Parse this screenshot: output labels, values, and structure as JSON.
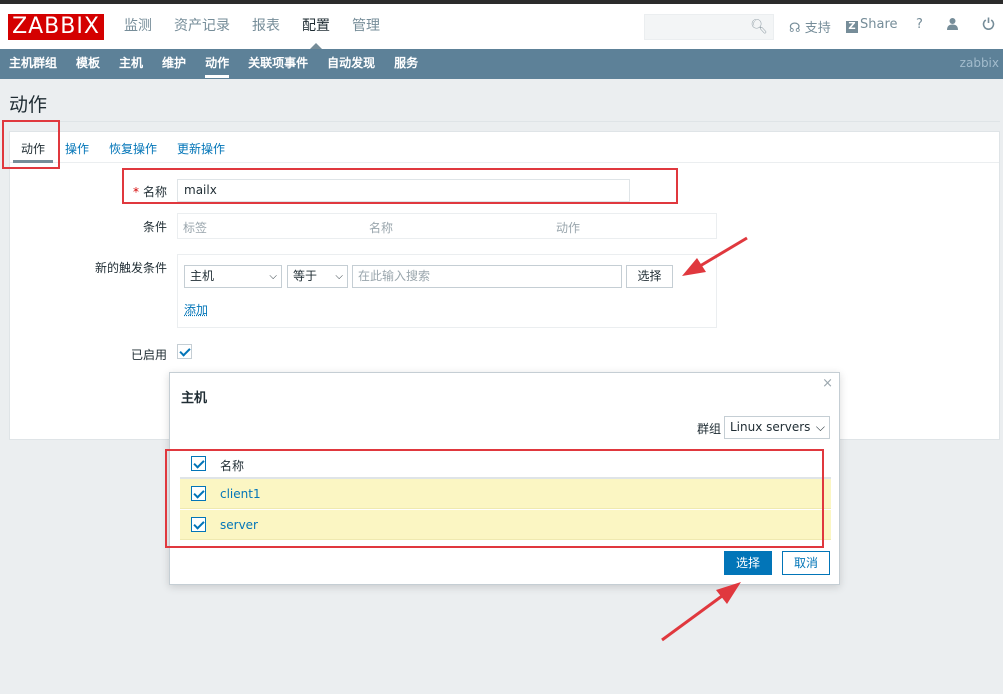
{
  "header": {
    "logo": "ZABBIX",
    "nav": [
      "监测",
      "资产记录",
      "报表",
      "配置",
      "管理"
    ],
    "active_nav": "配置",
    "support": "支持",
    "share": "Share",
    "help": "?",
    "brand_letter": "Z"
  },
  "subnav": {
    "items": [
      "主机群组",
      "模板",
      "主机",
      "维护",
      "动作",
      "关联项事件",
      "自动发现",
      "服务"
    ],
    "active": "动作",
    "brand": "zabbix"
  },
  "page": {
    "title": "动作"
  },
  "tabs": [
    "动作",
    "操作",
    "恢复操作",
    "更新操作"
  ],
  "form": {
    "name_label": "名称",
    "name_value": "mailx",
    "conditions_label": "条件",
    "conditions_columns": [
      "标签",
      "名称",
      "动作"
    ],
    "new_condition_label": "新的触发条件",
    "condition_type": "主机",
    "condition_operator": "等于",
    "search_placeholder": "在此输入搜索",
    "select_button": "选择",
    "add_link": "添加",
    "enabled_label": "已启用",
    "enabled": true
  },
  "modal": {
    "title": "主机",
    "close": "×",
    "group_label": "群组",
    "group_value": "Linux servers",
    "column_header": "名称",
    "rows": [
      {
        "name": "client1",
        "checked": true
      },
      {
        "name": "server",
        "checked": true
      }
    ],
    "select_button": "选择",
    "cancel_button": "取消"
  },
  "colors": {
    "accent": "#0275b8",
    "subnav_bg": "#5d8198",
    "logo_bg": "#d40000",
    "annotation": "#e0383e",
    "row_highlight": "#fbf6c3"
  }
}
